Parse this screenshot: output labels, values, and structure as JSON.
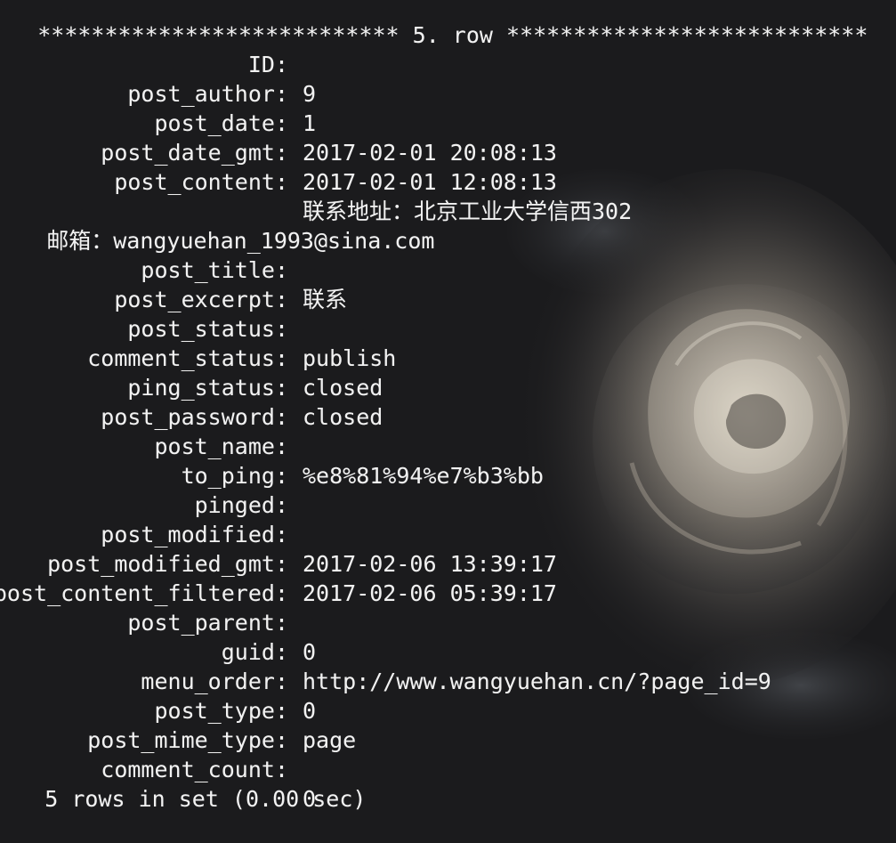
{
  "terminal": {
    "row_header": "*************************** 5. row ***************************",
    "fields": [
      {
        "name": "ID",
        "value": "9"
      },
      {
        "name": "post_author",
        "value": "1"
      },
      {
        "name": "post_date",
        "value": "2017-02-01 20:08:13"
      },
      {
        "name": "post_date_gmt",
        "value": "2017-02-01 12:08:13"
      },
      {
        "name": "post_content",
        "value": "联系地址：北京工业大学信西302"
      }
    ],
    "content_continuation": "邮箱：wangyuehan_1993@sina.com",
    "fields_after": [
      {
        "name": "post_title",
        "value": "联系"
      },
      {
        "name": "post_excerpt",
        "value": ""
      },
      {
        "name": "post_status",
        "value": "publish"
      },
      {
        "name": "comment_status",
        "value": "closed"
      },
      {
        "name": "ping_status",
        "value": "closed"
      },
      {
        "name": "post_password",
        "value": ""
      },
      {
        "name": "post_name",
        "value": "%e8%81%94%e7%b3%bb"
      },
      {
        "name": "to_ping",
        "value": ""
      },
      {
        "name": "pinged",
        "value": ""
      },
      {
        "name": "post_modified",
        "value": "2017-02-06 13:39:17"
      },
      {
        "name": "post_modified_gmt",
        "value": "2017-02-06 05:39:17"
      },
      {
        "name": "post_content_filtered",
        "value": ""
      },
      {
        "name": "post_parent",
        "value": "0"
      },
      {
        "name": "guid",
        "value": "http://www.wangyuehan.cn/?page_id=9"
      },
      {
        "name": "menu_order",
        "value": "0"
      },
      {
        "name": "post_type",
        "value": "page"
      },
      {
        "name": "post_mime_type",
        "value": ""
      },
      {
        "name": "comment_count",
        "value": "0"
      }
    ],
    "summary": "5 rows in set (0.00 sec)",
    "colors": {
      "background": "#1b1b1d",
      "text": "#f2f2f2"
    }
  }
}
